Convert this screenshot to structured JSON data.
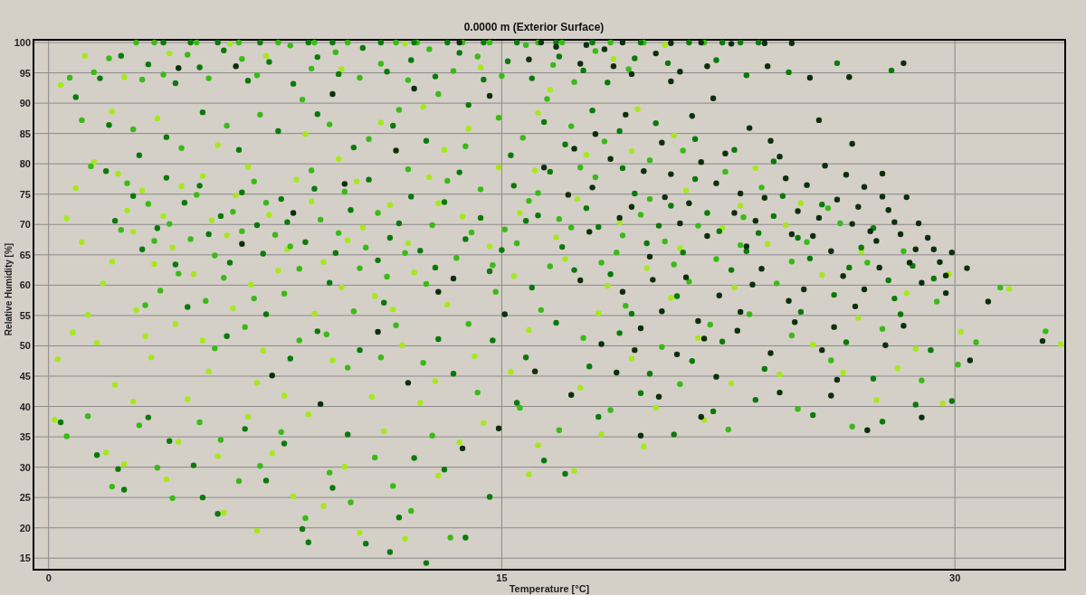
{
  "chart": {
    "chart_data": {
      "type": "scatter",
      "title": "0.0000 m (Exterior Surface)",
      "xlabel": "Temperature [°C]",
      "ylabel": "Relative Humidity [%]",
      "grid": true,
      "xlim": [
        -0.5,
        33.65
      ],
      "ylim": [
        13.1,
        100.45
      ],
      "xticks": [
        0,
        15,
        30
      ],
      "yticks": [
        15,
        20,
        25,
        30,
        35,
        40,
        45,
        50,
        55,
        60,
        65,
        70,
        75,
        80,
        85,
        90,
        95,
        100
      ],
      "series": [
        {
          "color": "#a6e81c",
          "x": [
            1.2,
            2.5,
            0.4,
            4.0,
            7.2,
            3.6,
            2.1,
            8.5,
            5.6,
            11,
            13.9,
            16.2,
            16.6,
            17.8,
            19.5,
            12.4,
            9.7,
            14.3,
            18.7,
            20.4,
            6.0,
            11.8,
            1.5,
            0.9,
            0.6,
            2.3,
            3.1,
            2.6,
            1.1,
            2.8,
            4.1,
            3.5,
            4.8,
            5.4,
            6.2,
            7.3,
            5.1,
            8.2,
            9.6,
            7.9,
            6.7,
            9.1,
            10.4,
            11.3,
            12.6,
            13.7,
            14.6,
            10.8,
            12.1,
            8.8,
            6.1,
            4.2,
            2.9,
            1.8,
            13.2,
            15.4,
            16.8,
            17.5,
            18.9,
            16.1,
            19.8,
            20.6,
            18.2,
            15.9,
            14.1,
            11.7,
            9.4,
            7.1,
            5.3,
            3.4,
            1.6,
            0.3,
            2.2,
            4.6,
            6.9,
            8.6,
            10.7,
            12.8,
            15.3,
            17.6,
            19.3,
            21.5,
            22.7,
            23.8,
            24.9,
            25.6,
            26.8,
            28.1,
            27.4,
            24.2,
            29.6,
            29.8,
            31.8,
            33.5,
            30.2,
            0.2,
            1.9,
            2.5,
            4.3,
            3.9,
            5.6,
            6.6,
            7.4,
            8.1,
            9.1,
            10.3,
            11.8,
            12.9,
            13.6,
            14.4,
            16.2,
            18.3,
            20.1,
            21.7,
            22.6,
            5.8,
            6.9,
            9.8,
            11.1,
            12.3,
            7.8,
            15.9,
            17.4,
            19.7,
            2.8,
            21.1,
            22.3,
            23.4,
            19.3,
            20.7,
            25.3,
            26.3,
            28.7,
            28.4,
            3.8,
            5.9,
            6.6,
            8.7,
            9.9,
            11.9,
            12.9,
            14.9,
            15.6,
            13.1,
            10.2,
            4.4,
            2.1,
            7.6,
            9.7,
            11.4,
            17.1,
            18.5,
            20.9,
            22.9,
            24.4,
            26.9,
            1.3,
            0.8,
            3.2,
            5.1
          ],
          "values": [
            97.8,
            94.3,
            93,
            98.2,
            97.8,
            87.5,
            88.6,
            84.9,
            83.1,
            86.8,
            85.8,
            88.4,
            92.2,
            81.5,
            89,
            89.4,
            95.6,
            95.9,
            97.3,
            99.6,
            99.8,
            99.8,
            80.3,
            76,
            71,
            78.4,
            75.6,
            72.3,
            67.1,
            68.8,
            66.2,
            63.5,
            61.8,
            70.7,
            74.8,
            71.6,
            78,
            77.4,
            80.8,
            65.9,
            60.1,
            63.8,
            69.5,
            73.2,
            77.8,
            71.3,
            66.4,
            58.2,
            62.1,
            55.3,
            56.2,
            53.6,
            55.9,
            60.3,
            56.8,
            61.5,
            67.9,
            74.2,
            70.3,
            78.9,
            62.8,
            57.9,
            55.4,
            52.6,
            48.3,
            50.1,
            47.6,
            49.2,
            45.8,
            48.1,
            50.5,
            47.8,
            43.6,
            41.2,
            43.9,
            38.7,
            41.6,
            44.2,
            45.7,
            43.1,
            47.9,
            51.3,
            59.6,
            66.8,
            73.5,
            61.7,
            54.6,
            46.3,
            41.1,
            45.3,
            40.5,
            61.8,
            59.4,
            50.3,
            52.3,
            37.8,
            32.4,
            30.5,
            34.2,
            28,
            31.8,
            38.3,
            32.3,
            25.2,
            23.6,
            19.2,
            18.2,
            28.6,
            34.1,
            37.3,
            33.6,
            35.4,
            39.8,
            37.8,
            43.8,
            22.5,
            19.5,
            30.1,
            35.9,
            40.6,
            41.8,
            28.8,
            29.4,
            33.4,
            40.8,
            75.6,
            69.4,
            79.3,
            82.1,
            84.7,
            50.2,
            45.6,
            49.5,
            58.7,
            71.4,
            68.2,
            79.5,
            73.8,
            67.4,
            66.9,
            73.5,
            79.4,
            71.9,
            82.3,
            77.1,
            76.3,
            63.9,
            62.4,
            59.6,
            56,
            64.3,
            59.9,
            66.1,
            73.1,
            69.9,
            65.5,
            55.1,
            52.2,
            51.6,
            50.9
          ]
        },
        {
          "color": "#3aba16",
          "x": [
            0.7,
            1.5,
            2.0,
            3.1,
            3.8,
            4.6,
            5.3,
            6.4,
            6.9,
            8.0,
            8.7,
            9.5,
            10.3,
            11.0,
            11.9,
            12.6,
            13.4,
            14.2,
            15.0,
            15.8,
            16.7,
            17.4,
            18.1,
            19.2,
            2.9,
            4.9,
            7.6,
            9.9,
            12.2,
            14.6,
            17.0,
            19.7,
            1.1,
            2.8,
            4.4,
            5.9,
            7.0,
            8.4,
            9.3,
            10.6,
            11.6,
            12.9,
            13.8,
            14.9,
            15.7,
            16.5,
            17.3,
            18.4,
            19.9,
            21.0,
            22.4,
            23.6,
            1.4,
            2.6,
            3.3,
            4.0,
            4.7,
            5.5,
            6.1,
            6.8,
            7.5,
            8.3,
            9.0,
            9.8,
            10.5,
            11.2,
            11.9,
            12.7,
            13.5,
            14.3,
            15.1,
            15.9,
            16.6,
            17.3,
            18.1,
            18.8,
            19.6,
            20.4,
            21.2,
            22.1,
            23.0,
            24.1,
            25.1,
            26.2,
            27.1,
            28.3,
            29.4,
            3.7,
            5.2,
            6.5,
            7.8,
            9.2,
            10.1,
            11.5,
            12.4,
            13.9,
            14.8,
            16.3,
            17.7,
            19.1,
            20.3,
            21.9,
            23.2,
            24.6,
            25.9,
            27.6,
            28.9,
            0.6,
            1.3,
            2.1,
            3.0,
            3.6,
            4.1,
            5.0,
            5.7,
            6.3,
            7.0,
            7.7,
            8.5,
            9.3,
            10.0,
            10.8,
            11.4,
            12.0,
            12.7,
            13.3,
            14.2,
            15.6,
            16.9,
            18.6,
            20.9,
            22.5,
            24.8,
            26.6,
            31.5,
            33.0,
            30.7,
            30.1,
            2.4,
            3.5,
            4.9,
            5.8,
            6.4,
            7.2,
            8.0,
            8.7,
            9.6,
            10.3,
            10.9,
            11.8,
            12.5,
            13.2,
            14.0,
            14.7,
            15.5,
            16.2,
            16.9,
            17.6,
            18.3,
            19.0,
            19.9,
            20.7,
            21.5,
            22.9,
            24.6,
            25.8,
            3.2,
            4.3,
            5.5,
            6.8,
            8.3,
            9.9,
            11.0,
            3.5,
            6.3,
            8.8,
            11.5,
            13.7,
            16.2,
            18.6,
            21.7
          ],
          "values": [
            94.2,
            95.1,
            97.4,
            93.9,
            94.7,
            98,
            94.1,
            97.3,
            94.6,
            99.5,
            95.7,
            98.4,
            94.2,
            96.5,
            93.8,
            98.9,
            95.3,
            97.7,
            94.5,
            99.6,
            96.3,
            93.5,
            98.6,
            95.6,
            100,
            100,
            100,
            100,
            100,
            100,
            100,
            100,
            87.2,
            85.7,
            82.6,
            86.3,
            88.1,
            90.6,
            86.5,
            84.1,
            88.9,
            91.5,
            82.9,
            87.6,
            84.3,
            90.7,
            86.2,
            83.7,
            80.6,
            82.2,
            78.7,
            76.1,
            79.6,
            76.8,
            73.4,
            70.1,
            67.6,
            64.9,
            72.1,
            77.1,
            68.3,
            62.7,
            70.8,
            75.4,
            66.2,
            61.4,
            79.1,
            69.9,
            64.5,
            75.8,
            69.2,
            73.9,
            63.1,
            69.5,
            77.8,
            65.4,
            71.6,
            67.2,
            60.6,
            64.3,
            71.2,
            60.3,
            67.1,
            70.2,
            63.7,
            65.6,
            57.3,
            59.1,
            57.4,
            53.1,
            58.6,
            51.9,
            55.7,
            53.4,
            47.2,
            53.6,
            58.9,
            55.9,
            51.3,
            56.6,
            49.8,
            53.5,
            55.2,
            51.7,
            47.6,
            52.8,
            44.3,
            35.1,
            38.4,
            26.8,
            36.9,
            29.9,
            24.9,
            37.4,
            34.5,
            27.7,
            30.2,
            35.8,
            21.6,
            29.1,
            24.2,
            31.6,
            26.9,
            22.8,
            35.2,
            18.4,
            42.3,
            39.8,
            36.1,
            39.4,
            43.7,
            36.2,
            39.6,
            36.7,
            59.6,
            52.4,
            50.6,
            46.9,
            69.1,
            67.3,
            74.9,
            61.2,
            68.9,
            73.6,
            66.4,
            78.9,
            68.6,
            62.8,
            71.9,
            65.3,
            60.2,
            77.2,
            68.7,
            63.3,
            66.9,
            75.2,
            70.9,
            79.4,
            63.7,
            68.2,
            74.2,
            63.4,
            69.8,
            66.6,
            63.9,
            72.7,
            56.7,
            61.9,
            49.6,
            57.8,
            50.9,
            46.4,
            48.1,
            100,
            100,
            100,
            100,
            100,
            100,
            100,
            100
          ]
        },
        {
          "color": "#0b7a0b",
          "x": [
            0.9,
            1.7,
            2.4,
            3.3,
            4.2,
            5.0,
            5.8,
            6.6,
            7.3,
            8.1,
            8.9,
            9.6,
            10.4,
            11.2,
            12.0,
            12.8,
            13.6,
            14.4,
            15.2,
            16.0,
            16.9,
            17.7,
            18.5,
            19.4,
            20.5,
            22.1,
            23.1,
            24.5,
            26.1,
            27.9,
            3.8,
            5.6,
            8.6,
            11.0,
            13.2,
            15.5,
            18.0,
            21.2,
            22.9,
            2.0,
            3.9,
            5.1,
            6.3,
            7.6,
            8.9,
            10.1,
            11.4,
            12.5,
            13.9,
            15.3,
            16.4,
            17.1,
            18.0,
            18.9,
            20.1,
            21.4,
            22.7,
            24.0,
            3.0,
            1.9,
            2.2,
            3.1,
            3.9,
            4.5,
            5.3,
            6.0,
            6.9,
            7.7,
            8.5,
            9.3,
            10.0,
            10.9,
            11.6,
            12.3,
            13.1,
            13.8,
            14.6,
            15.4,
            16.2,
            17.0,
            17.8,
            18.6,
            19.4,
            20.2,
            21.0,
            21.8,
            22.6,
            23.5,
            24.3,
            25.2,
            26.0,
            26.9,
            27.8,
            28.6,
            29.3,
            4.6,
            5.9,
            7.2,
            8.0,
            8.9,
            10.3,
            11.1,
            12.9,
            13.4,
            14.7,
            15.8,
            16.8,
            17.9,
            18.9,
            19.9,
            21.3,
            22.3,
            23.7,
            24.9,
            26.4,
            27.3,
            28.2,
            29.2,
            0.4,
            1.6,
            2.3,
            2.5,
            3.3,
            4.0,
            4.8,
            5.1,
            5.6,
            6.5,
            7.2,
            7.8,
            8.4,
            8.6,
            9.4,
            9.9,
            10.5,
            11.3,
            11.6,
            12.1,
            12.5,
            13.1,
            13.8,
            14.6,
            15.5,
            16.4,
            17.1,
            18.2,
            19.6,
            20.7,
            22.0,
            23.4,
            25.3,
            27.6,
            28.7,
            29.9,
            2.8,
            3.6,
            4.2,
            5.0,
            5.7,
            6.4,
            7.1,
            7.9,
            8.8,
            9.5,
            10.6,
            11.3,
            12.0,
            12.8,
            13.6,
            14.3,
            15.0,
            15.8,
            16.6,
            17.4,
            18.2,
            19.0,
            19.8,
            20.6,
            21.4,
            22.2,
            23.1,
            24.0,
            24.8,
            25.6,
            26.5,
            27.3,
            28.0,
            20.8,
            19.3,
            16.0,
            4.7,
            7.0,
            9.4,
            12.1,
            14.4,
            16.8,
            19.6,
            22.3,
            23.5
          ],
          "values": [
            91,
            94.1,
            97.8,
            96.4,
            93.3,
            95.9,
            98.7,
            93.7,
            96.8,
            93.2,
            97.6,
            94.8,
            99.1,
            95.2,
            97.1,
            94.4,
            98.3,
            93.9,
            96.9,
            94.1,
            97.7,
            95.4,
            93.4,
            97.4,
            96.6,
            97.1,
            94.6,
            95.1,
            96.6,
            95.4,
            100,
            100,
            100,
            100,
            100,
            100,
            100,
            100,
            100,
            86.4,
            84.4,
            88.5,
            82.3,
            85.4,
            88.2,
            82.7,
            86.3,
            83.8,
            89.7,
            81.4,
            86.9,
            83.2,
            88.8,
            85.4,
            86.7,
            84.1,
            82.3,
            80.4,
            81.4,
            78.8,
            70.6,
            65.9,
            77.7,
            73.6,
            68.4,
            63.7,
            69.9,
            74.2,
            67.1,
            60.4,
            72.4,
            64.1,
            70.2,
            65.7,
            73.7,
            67.6,
            62.3,
            76.4,
            71.5,
            66.3,
            72.7,
            61.8,
            75.1,
            69.8,
            65.4,
            71.9,
            62.5,
            68.6,
            74.7,
            64.4,
            58.4,
            66.2,
            60.8,
            63.2,
            61.1,
            56.4,
            51.6,
            55.2,
            47.9,
            52.4,
            49.3,
            57.1,
            51.1,
            45.4,
            50.9,
            48.1,
            53.8,
            46.6,
            52.1,
            45.4,
            47.5,
            50.7,
            46.2,
            55.6,
            50.6,
            44.6,
            55.2,
            49.3,
            37.4,
            32,
            29.7,
            26.3,
            38.2,
            34.3,
            30.3,
            25,
            22.3,
            36.3,
            27.8,
            33.9,
            19.8,
            17.6,
            26.6,
            35.4,
            17.4,
            16,
            21.7,
            31.5,
            14.2,
            29.6,
            18.4,
            25.1,
            40.6,
            31.1,
            28.9,
            38.3,
            42.2,
            35.4,
            39.2,
            41.1,
            38.6,
            37.5,
            40.3,
            40.9,
            74.7,
            69.4,
            63.4,
            76.4,
            71.4,
            75.3,
            65.2,
            70.4,
            75.9,
            65.3,
            77.4,
            67.8,
            74.6,
            62.9,
            78.6,
            71.1,
            65.8,
            70.6,
            78.7,
            62.5,
            69.6,
            79.3,
            66.9,
            73.1,
            77.5,
            68.9,
            65.6,
            71.4,
            67.8,
            73.3,
            62.9,
            69.4,
            57.8,
            58.2,
            55.3,
            59.6,
            100,
            100,
            100,
            100,
            100,
            100,
            100,
            100,
            100
          ]
        },
        {
          "color": "#0c2f0c",
          "x": [
            15.9,
            16.8,
            17.6,
            18.4,
            19.3,
            20.1,
            20.9,
            21.8,
            13.6,
            16.3,
            19.0,
            21.6,
            24.6,
            28.3,
            26.5,
            23.8,
            25.2,
            16.4,
            17.2,
            17.9,
            18.6,
            19.3,
            19.9,
            20.6,
            21.2,
            21.8,
            22.4,
            22.9,
            23.4,
            23.9,
            24.4,
            24.8,
            25.3,
            25.7,
            26.1,
            26.6,
            27.0,
            27.4,
            27.8,
            28.2,
            28.7,
            29.1,
            29.5,
            29.9,
            28.9,
            27.5,
            26.3,
            25.0,
            23.6,
            22.2,
            21.1,
            20.3,
            19.0,
            17.6,
            18.3,
            19.6,
            20.8,
            21.5,
            22.8,
            23.9,
            24.7,
            25.6,
            26.7,
            27.7,
            28.3,
            26.1,
            24.2,
            22.1,
            20.2,
            18.8,
            17.3,
            23.2,
            21.3,
            20.3,
            19.1,
            18.1,
            22.0,
            14.6,
            12.1,
            9.4,
            6.2,
            4.3,
            11.5,
            9.8,
            8.1,
            6.4,
            12.9,
            10.9,
            13.4,
            15.1,
            16.1,
            14.9,
            13.7,
            11.9,
            9.0,
            7.4,
            27.1,
            28.9,
            30.5,
            31.1,
            32.9,
            30.4,
            29.7,
            21.6,
            19.6,
            26.6,
            25.5,
            27.6,
            28.4,
            17.4,
            18.0,
            18.9,
            19.7,
            20.4,
            20.9,
            21.6,
            22.1,
            22.7,
            23.1,
            23.7,
            24.2,
            24.6,
            25.1,
            25.5,
            25.9,
            26.4,
            26.8,
            27.2,
            27.6,
            28.0,
            28.5,
            28.8,
            29.3,
            29.7,
            26.0,
            24.5,
            22.9,
            21.7,
            20.0,
            19.4,
            23.3,
            27.0,
            25.9,
            17.8,
            20.6,
            22.6,
            23.7,
            18.7,
            20.6
          ],
          "values": [
            97.2,
            99.3,
            96.5,
            98.9,
            94.8,
            98.2,
            95.2,
            96.1,
            100,
            100,
            100,
            100,
            99.9,
            96.6,
            94.3,
            96.1,
            94.2,
            79.4,
            74.9,
            68.8,
            80.8,
            72.9,
            64.7,
            78.3,
            73.5,
            68.1,
            81.7,
            75.1,
            70.6,
            83.8,
            77.6,
            72.2,
            68.1,
            79.7,
            74.1,
            70.1,
            76.2,
            67.3,
            72.4,
            68.4,
            65.9,
            67.8,
            63.8,
            65.4,
            60.4,
            62.9,
            61.5,
            59.3,
            62.7,
            58.3,
            61.3,
            55.7,
            58.9,
            60.8,
            50.3,
            52.9,
            48.6,
            54.1,
            52.5,
            48.8,
            53.9,
            49.3,
            56.5,
            50.1,
            53.3,
            44.4,
            42.3,
            44.9,
            41.6,
            45.6,
            41.9,
            85.9,
            87.9,
            83.5,
            88.1,
            84.9,
            90.8,
            91.2,
            92.4,
            91.5,
            96.1,
            95.8,
            82.2,
            76.7,
            71.9,
            66.8,
            58.9,
            52.3,
            61.1,
            55.2,
            45.8,
            36.4,
            33.1,
            43.9,
            40.4,
            45.1,
            36.1,
            38.2,
            47.6,
            57.3,
            50.8,
            62.8,
            58.7,
            38.3,
            35.2,
            83.3,
            87.2,
            78.4,
            74.5,
            82.5,
            76.1,
            71.1,
            78.8,
            74.5,
            70.2,
            80.3,
            76.8,
            71.9,
            66.4,
            74.4,
            81.2,
            68.4,
            76.5,
            71.1,
            65.6,
            78.2,
            72.9,
            68.9,
            74.6,
            70.4,
            63.7,
            70.2,
            65.9,
            61.6,
            53.1,
            57.4,
            55.6,
            51.2,
            60.9,
            49.3,
            60.1,
            59.3,
            41.8,
            99.6,
            99.9,
            99.8,
            99.9,
            96.1,
            93.6
          ]
        }
      ]
    }
  }
}
